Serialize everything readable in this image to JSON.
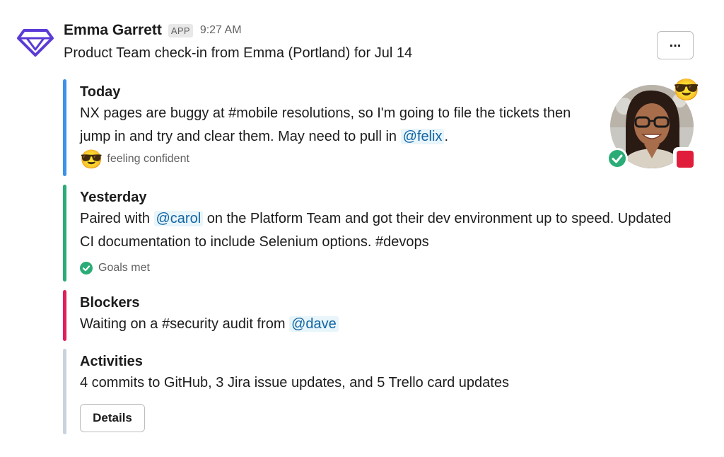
{
  "message": {
    "author": "Emma Garrett",
    "app_badge": "APP",
    "time": "9:27 AM",
    "subtitle": "Product Team check-in from Emma (Portland) for Jul 14",
    "more_label": "..."
  },
  "today": {
    "title": "Today",
    "text_before": "NX pages are buggy at #mobile resolutions, so I'm going to file the tickets then jump in and try and clear them. May need to pull in ",
    "mention": "@felix",
    "text_after": ".",
    "mood_emoji": "😎",
    "mood_text": "feeling confident"
  },
  "yesterday": {
    "title": "Yesterday",
    "text_before": "Paired with ",
    "mention": "@carol",
    "text_after": " on the Platform Team and got their dev environment up to speed. Updated CI documentation to include Selenium options. #devops",
    "status_text": "Goals met"
  },
  "blockers": {
    "title": "Blockers",
    "text_before": "Waiting on a #security audit from ",
    "mention": "@dave"
  },
  "activities": {
    "title": "Activities",
    "text": "4 commits to GitHub, 3 Jira issue updates, and 5 Trello card updates",
    "details_label": "Details"
  },
  "avatar": {
    "emoji": "😎"
  },
  "colors": {
    "today_bar": "#3b92e8",
    "yesterday_bar": "#2bac76",
    "blockers_bar": "#e01e5a",
    "activities_bar": "#c8d3de",
    "mention": "#1264a3",
    "logo": "#5b3bd6"
  }
}
